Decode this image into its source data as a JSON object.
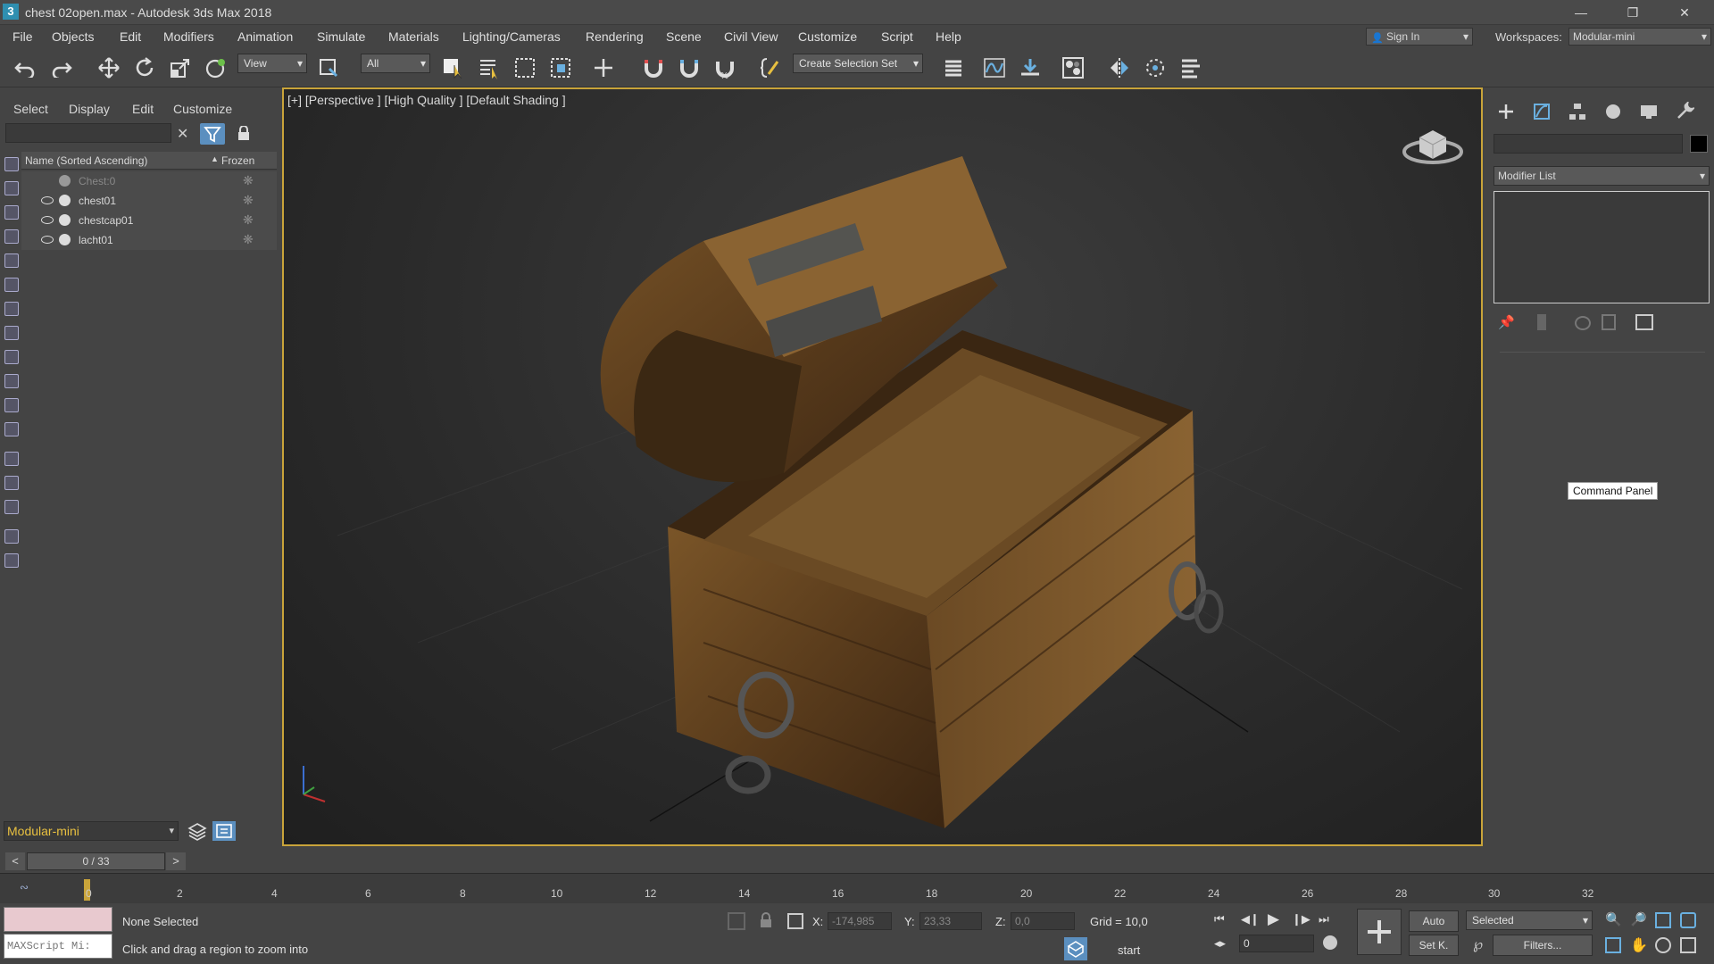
{
  "titlebar": {
    "app_icon": "3",
    "title": "chest 02open.max - Autodesk 3ds Max 2018",
    "minimize": "—",
    "restore": "❐",
    "close": "✕"
  },
  "menu": [
    "File",
    "Objects",
    "Edit",
    "Modifiers",
    "Animation",
    "Simulate",
    "Materials",
    "Lighting/Cameras",
    "Rendering",
    "Scene",
    "Civil View",
    "Customize",
    "Script",
    "Help"
  ],
  "account": {
    "sign_in": "Sign In",
    "workspaces_label": "Workspaces:",
    "workspace": "Modular-mini"
  },
  "toolbar": {
    "view_select": "View",
    "filter_select": "All",
    "selection_set": "Create Selection Set"
  },
  "scene_explorer": {
    "tabs": [
      "Select",
      "Display",
      "Edit",
      "Customize"
    ],
    "col_name": "Name (Sorted Ascending)",
    "col_frozen": "Frozen",
    "rows": [
      {
        "name": "Chest:0",
        "dim": true
      },
      {
        "name": "chest01",
        "dim": false
      },
      {
        "name": "chestcap01",
        "dim": false
      },
      {
        "name": "lacht01",
        "dim": false
      }
    ],
    "workspace": "Modular-mini"
  },
  "viewport": {
    "label": "[+] [Perspective ] [High Quality ] [Default Shading ]"
  },
  "command_panel": {
    "modifier_list": "Modifier List",
    "tooltip": "Command Panel"
  },
  "timeline": {
    "frame": "0 / 33",
    "ticks": [
      "0",
      "2",
      "4",
      "6",
      "8",
      "10",
      "12",
      "14",
      "16",
      "18",
      "20",
      "22",
      "24",
      "26",
      "28",
      "30",
      "32"
    ]
  },
  "status": {
    "maxscript": "MAXScript Mi:",
    "selection": "None Selected",
    "prompt": "Click and drag a region to zoom into",
    "x_label": "X:",
    "x": "-174,985",
    "y_label": "Y:",
    "y": "23,33",
    "z_label": "Z:",
    "z": "0,0",
    "grid": "Grid = 10,0",
    "auto": "Auto",
    "setk": "Set K.",
    "selected": "Selected",
    "filters": "Filters...",
    "frame_field": "0",
    "start": "start"
  }
}
